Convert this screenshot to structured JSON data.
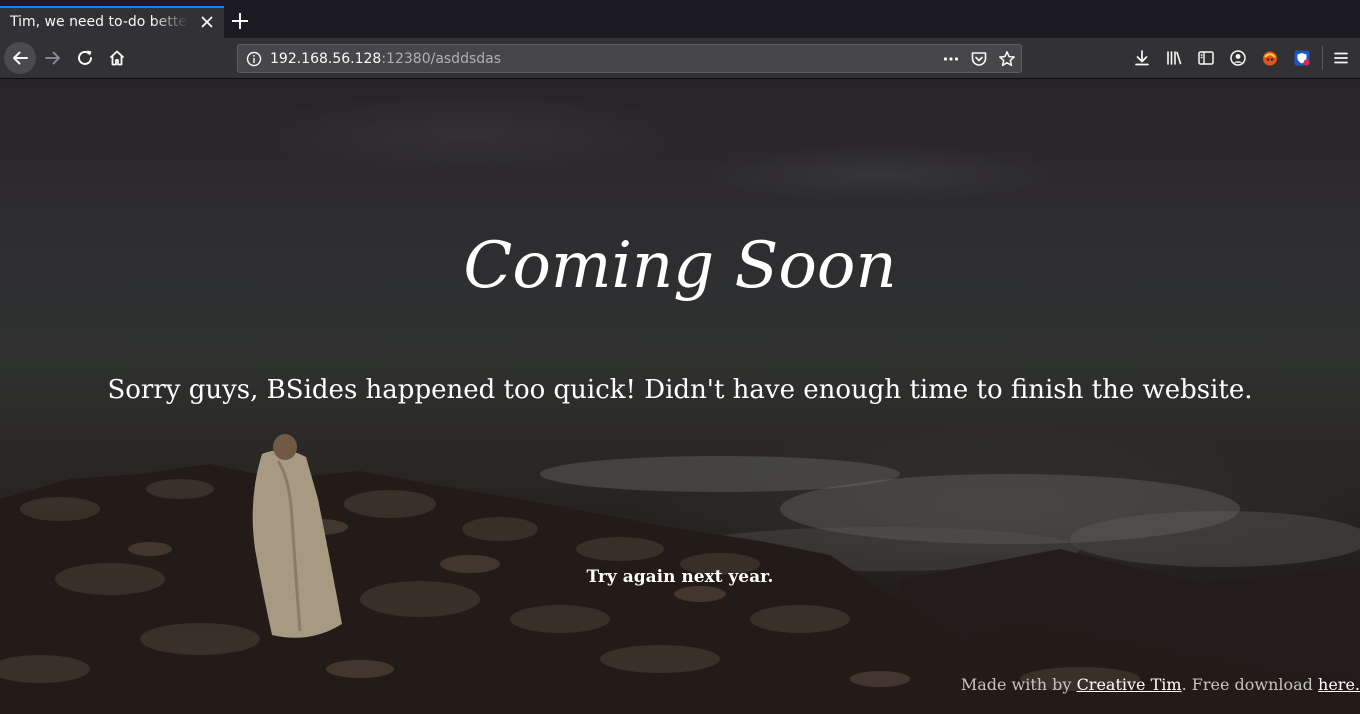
{
  "browser": {
    "tab": {
      "title": "Tim, we need to-do better next year for Initech"
    },
    "url": {
      "host": "192.168.56.128",
      "rest": ":12380/asddsdas"
    }
  },
  "page": {
    "heading": "Coming Soon",
    "subtitle": "Sorry guys, BSides happened too quick! Didn't have enough time to finish the website.",
    "note": "Try again next year.",
    "footer": {
      "prefix": "Made with by",
      "link1": "Creative Tim",
      "middle": ". Free download",
      "link2": "here."
    }
  },
  "icons": {
    "tab_close": "close-icon",
    "new_tab": "plus-icon",
    "back": "back-arrow-icon",
    "forward": "forward-arrow-icon",
    "reload": "reload-icon",
    "home": "home-icon",
    "site_info": "info-icon",
    "page_actions": "ellipsis-icon",
    "pocket": "pocket-icon",
    "bookmark": "star-icon",
    "downloads": "download-icon",
    "library": "library-icon",
    "sidebar": "sidebar-icon",
    "account": "account-icon",
    "extension1": "extension-icon",
    "extension2": "shield-extension-icon",
    "menu": "hamburger-menu-icon"
  },
  "colors": {
    "chrome_dark": "#1c1b22",
    "toolbar": "#323234",
    "tab_accent": "#0a84ff",
    "text": "#f9f9fa"
  }
}
